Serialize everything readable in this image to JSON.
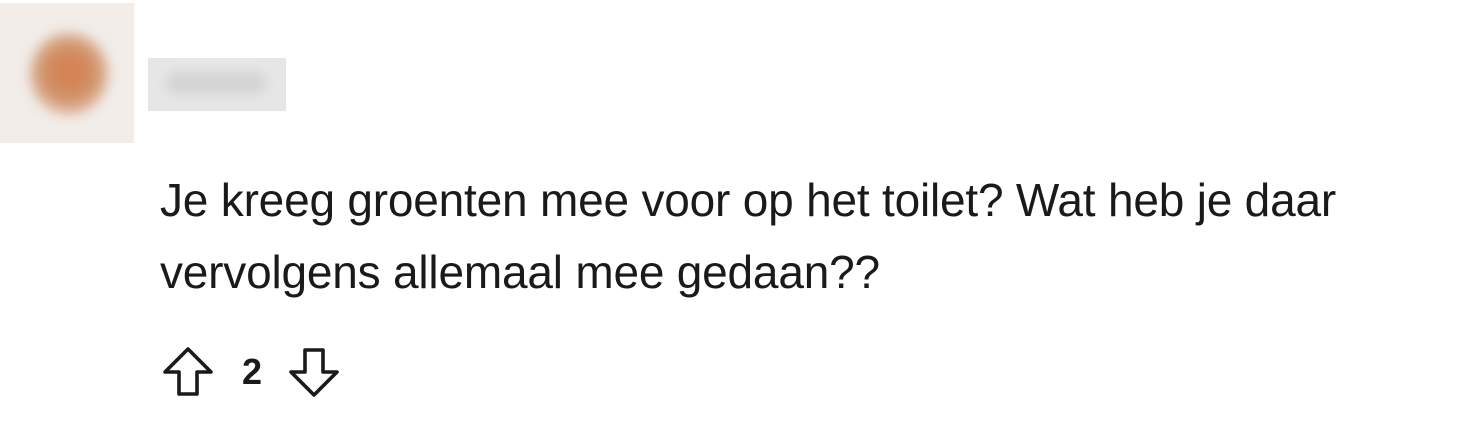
{
  "comment": {
    "author": "",
    "text_line_1": "Je kreeg groenten mee voor op het toilet? Wat heb je daar",
    "text_line_2": "vervolgens allemaal mee gedaan??",
    "score": "2",
    "icons": {
      "upvote": "arrow-up-outline-icon",
      "downvote": "arrow-down-outline-icon"
    }
  },
  "colors": {
    "text": "#1a1a1b",
    "background": "#ffffff",
    "avatar_accent": "#d9804f",
    "username_redaction": "#e6e6e6"
  }
}
